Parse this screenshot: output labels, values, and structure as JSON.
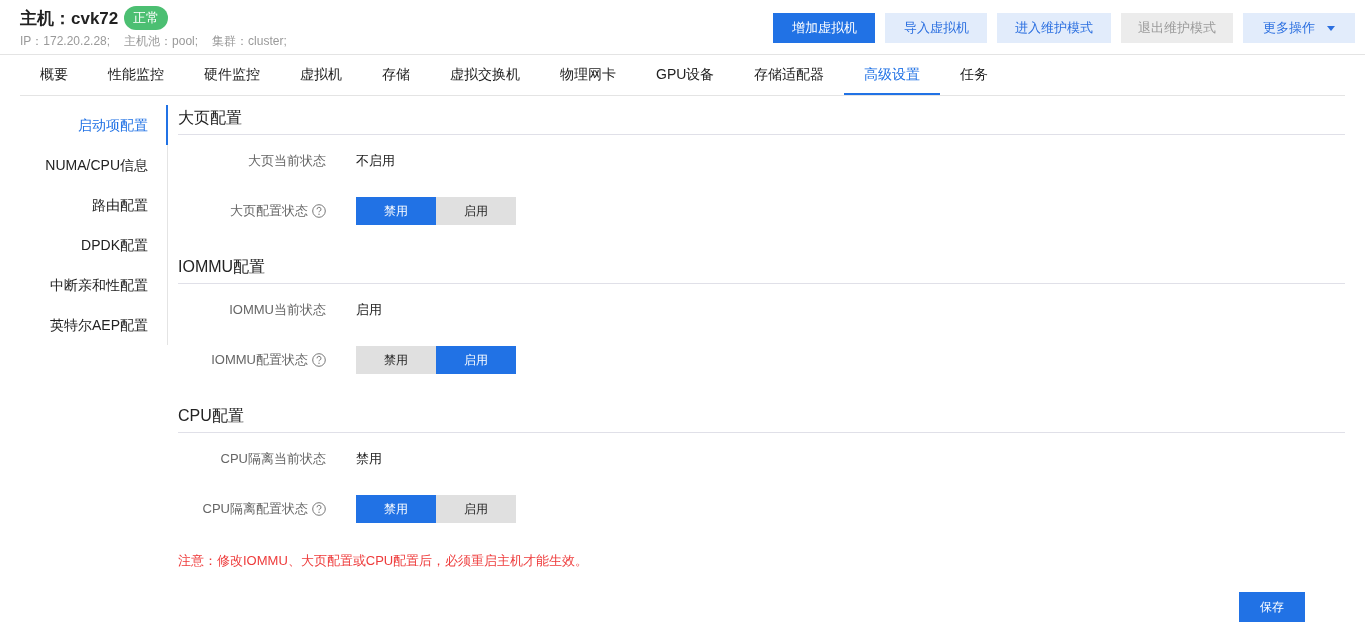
{
  "host": {
    "title": "主机：cvk72",
    "status": "正常",
    "meta": [
      "IP：172.20.2.28;",
      "主机池：pool;",
      "集群：cluster;"
    ]
  },
  "actions": [
    {
      "label": "增加虚拟机",
      "kind": "primary"
    },
    {
      "label": "导入虚拟机",
      "kind": "secondary"
    },
    {
      "label": "进入维护模式",
      "kind": "secondary"
    },
    {
      "label": "退出维护模式",
      "kind": "disabled"
    },
    {
      "label": "更多操作",
      "kind": "dropdown"
    }
  ],
  "tabs": [
    {
      "label": "概要",
      "selected": false
    },
    {
      "label": "性能监控",
      "selected": false
    },
    {
      "label": "硬件监控",
      "selected": false
    },
    {
      "label": "虚拟机",
      "selected": false
    },
    {
      "label": "存储",
      "selected": false
    },
    {
      "label": "虚拟交换机",
      "selected": false
    },
    {
      "label": "物理网卡",
      "selected": false
    },
    {
      "label": "GPU设备",
      "selected": false
    },
    {
      "label": "存储适配器",
      "selected": false
    },
    {
      "label": "高级设置",
      "selected": true
    },
    {
      "label": "任务",
      "selected": false
    }
  ],
  "sidebar": {
    "items": [
      {
        "label": "启动项配置",
        "selected": true
      },
      {
        "label": "NUMA/CPU信息",
        "selected": false
      },
      {
        "label": "路由配置",
        "selected": false
      },
      {
        "label": "DPDK配置",
        "selected": false
      },
      {
        "label": "中断亲和性配置",
        "selected": false
      },
      {
        "label": "英特尔AEP配置",
        "selected": false
      }
    ]
  },
  "sections": [
    {
      "title": "大页配置",
      "rows": [
        {
          "kind": "text",
          "label": "大页当前状态",
          "value": "不启用"
        },
        {
          "kind": "toggle",
          "label": "大页配置状态",
          "options": [
            {
              "label": "禁用",
              "selected": true
            },
            {
              "label": "启用",
              "selected": false
            }
          ]
        }
      ]
    },
    {
      "title": "IOMMU配置",
      "rows": [
        {
          "kind": "text",
          "label": "IOMMU当前状态",
          "value": "启用"
        },
        {
          "kind": "toggle",
          "label": "IOMMU配置状态",
          "options": [
            {
              "label": "禁用",
              "selected": false
            },
            {
              "label": "启用",
              "selected": true
            }
          ]
        }
      ]
    },
    {
      "title": "CPU配置",
      "rows": [
        {
          "kind": "text",
          "label": "CPU隔离当前状态",
          "value": "禁用"
        },
        {
          "kind": "toggle",
          "label": "CPU隔离配置状态",
          "options": [
            {
              "label": "禁用",
              "selected": true
            },
            {
              "label": "启用",
              "selected": false
            }
          ]
        }
      ]
    }
  ],
  "note": "注意：修改IOMMU、大页配置或CPU配置后，必须重启主机才能生效。",
  "save_button": "保存"
}
